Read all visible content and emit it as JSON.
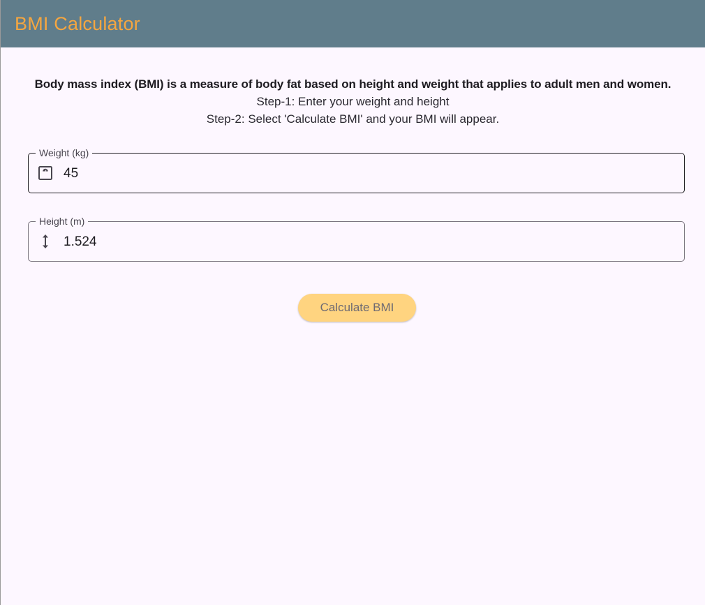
{
  "appbar": {
    "title": "BMI Calculator"
  },
  "intro": {
    "description": "Body mass index (BMI) is a measure of body fat based on height and weight that applies to adult men and women.",
    "step1": "Step-1: Enter your weight and height",
    "step2": "Step-2: Select 'Calculate BMI' and your BMI will appear."
  },
  "weight_field": {
    "label": "Weight (kg)",
    "value": "45",
    "icon": "scale-icon"
  },
  "height_field": {
    "label": "Height (m)",
    "value": "1.524",
    "icon": "vertical-arrows-icon"
  },
  "calculate_button": {
    "label": "Calculate BMI"
  },
  "colors": {
    "appbar_background": "#607d8b",
    "title_accent": "#f5a640",
    "button_background": "#ffd480",
    "page_background": "#fdf7ff"
  }
}
